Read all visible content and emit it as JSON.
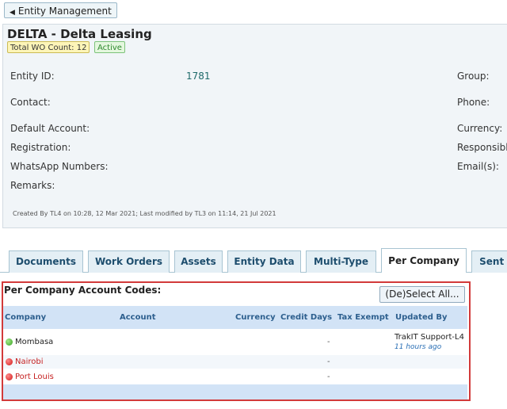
{
  "back_button": {
    "label": "Entity Management",
    "icon": "left-triangle-icon"
  },
  "entity": {
    "title": "DELTA - Delta Leasing",
    "wo_count": "Total WO Count: 12",
    "status": "Active",
    "fields": {
      "entity_id_label": "Entity ID:",
      "entity_id_value": "1781",
      "group_label": "Group:",
      "contact_label": "Contact:",
      "phone_label": "Phone:",
      "default_account_label": "Default Account:",
      "currency_label": "Currency:",
      "registration_label": "Registration:",
      "responsible_label": "Responsibl",
      "whatsapp_label": "WhatsApp Numbers:",
      "emails_label": "Email(s):",
      "remarks_label": "Remarks:"
    },
    "meta": "Created By TL4 on 10:28, 12 Mar 2021; Last modified by TL3 on 11:14, 21 Jul 2021"
  },
  "tabs": [
    {
      "label": "Documents"
    },
    {
      "label": "Work Orders"
    },
    {
      "label": "Assets"
    },
    {
      "label": "Entity Data"
    },
    {
      "label": "Multi-Type"
    },
    {
      "label": "Per Company",
      "active": true
    },
    {
      "label": "Sent I"
    }
  ],
  "per_company": {
    "title": "Per Company Account Codes:",
    "select_all": "(De)Select All...",
    "columns": [
      "Company",
      "Account",
      "Currency",
      "Credit Days",
      "Tax Exempt",
      "Updated By"
    ],
    "rows": [
      {
        "status": "green",
        "company": "Mombasa",
        "credit_days": "-",
        "updated_by": "TrakIT Support-L4",
        "updated_ago": "11 hours ago"
      },
      {
        "status": "red",
        "company": "Nairobi",
        "credit_days": "-",
        "updated_by": "",
        "updated_ago": ""
      },
      {
        "status": "red",
        "company": "Port Louis",
        "credit_days": "-",
        "updated_by": "",
        "updated_ago": ""
      }
    ]
  },
  "colors": {
    "accent": "#1e4e6e",
    "highlight": "#d23a3a",
    "active_green": "#35a020",
    "inactive_red": "#d01818"
  }
}
